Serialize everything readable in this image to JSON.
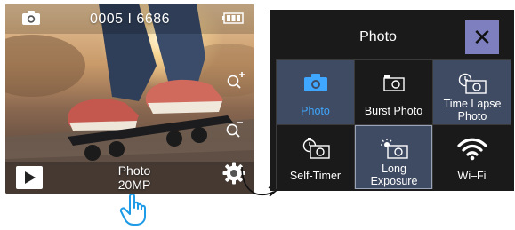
{
  "camera_view": {
    "counter": "0005 I 6686",
    "mode_line1": "Photo",
    "mode_line2": "20MP",
    "icons": {
      "camera": "camera-icon",
      "battery": "battery-icon",
      "zoom_in": "zoom-in-icon",
      "zoom_out": "zoom-out-icon",
      "playback": "play-icon",
      "settings": "gear-icon"
    }
  },
  "annotations": {
    "tap_hint": "hand-pointer-icon",
    "transition": "curved-arrow-icon"
  },
  "mode_menu": {
    "title": "Photo",
    "close_label": "✕",
    "items": [
      {
        "label": "Photo",
        "icon": "camera-icon",
        "state": "selected"
      },
      {
        "label": "Burst Photo",
        "icon": "burst-camera-icon",
        "state": "normal"
      },
      {
        "label": "Time Lapse Photo",
        "icon": "timelapse-camera-icon",
        "state": "highlighted"
      },
      {
        "label": "Self-Timer",
        "icon": "self-timer-icon",
        "state": "normal"
      },
      {
        "label": "Long Exposure",
        "icon": "long-exposure-icon",
        "state": "highlighted"
      },
      {
        "label": "Wi–Fi",
        "icon": "wifi-icon",
        "state": "normal"
      }
    ]
  },
  "colors": {
    "accent_blue": "#3fa7ff",
    "close_button": "#7d7fbf",
    "tile_highlight": "#3f4a63",
    "menu_background": "#1a1a1a"
  }
}
